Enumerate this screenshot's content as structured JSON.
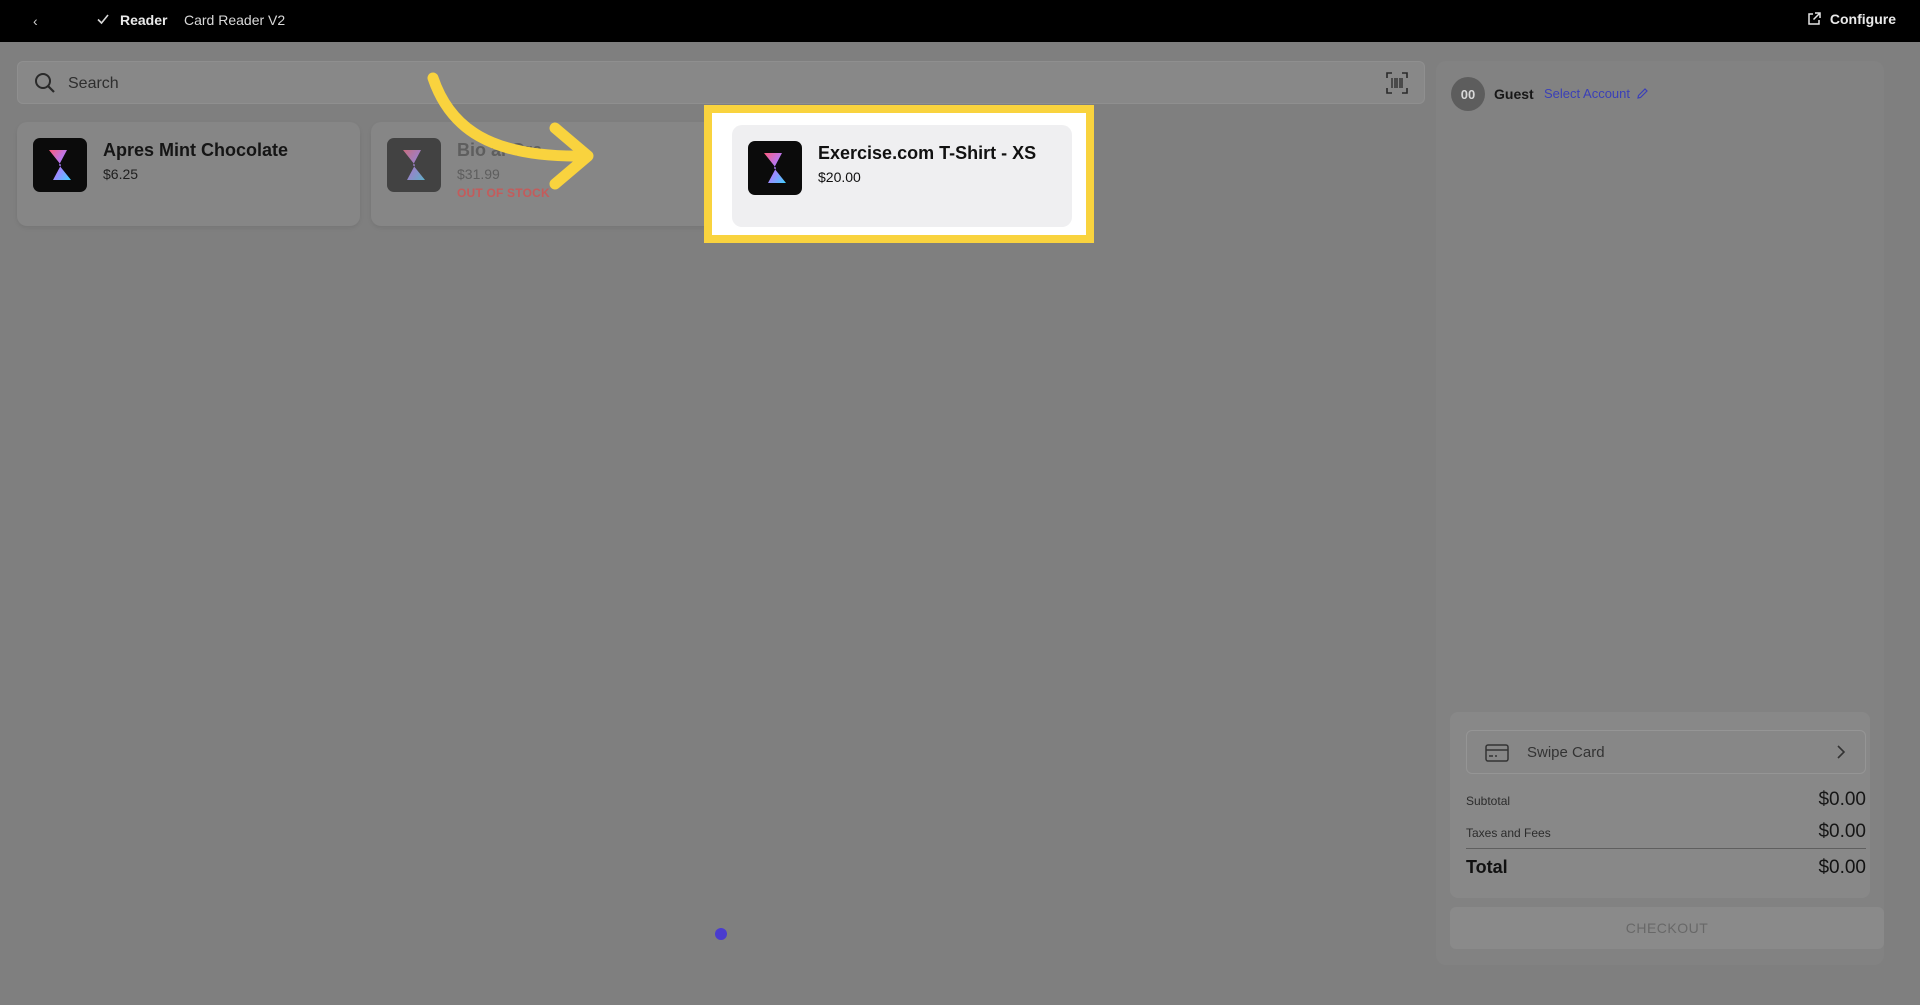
{
  "topbar": {
    "back_glyph": "‹",
    "reader_label": "Reader",
    "device_label": "Card Reader V2",
    "configure_label": "Configure"
  },
  "search": {
    "placeholder": "Search"
  },
  "products": [
    {
      "name": "Apres Mint Chocolate",
      "price": "$6.25",
      "status": ""
    },
    {
      "name": "Bio    al Gre",
      "price": "$31.99",
      "status": "OUT OF STOCK"
    },
    {
      "name": "Exercise.com T-Shirt - XS",
      "price": "$20.00",
      "status": ""
    }
  ],
  "cart": {
    "avatar_initials": "00",
    "guest_label": "Guest",
    "select_account_label": "Select Account",
    "swipe_card_label": "Swipe Card",
    "subtotal_label": "Subtotal",
    "subtotal_value": "$0.00",
    "taxes_label": "Taxes and Fees",
    "taxes_value": "$0.00",
    "total_label": "Total",
    "total_value": "$0.00",
    "checkout_label": "CHECKOUT"
  },
  "colors": {
    "highlight": "#f9d33e",
    "accent_link": "#3a3fb8",
    "out_of_stock": "#c45b5b",
    "pagination_dot": "#4a3ccf"
  },
  "icons": {
    "back": "chevron-left-icon",
    "check": "check-icon",
    "configure": "external-link-icon",
    "search": "search-icon",
    "scan": "barcode-scan-icon",
    "edit": "pencil-icon",
    "swipe": "credit-card-icon",
    "chevron": "chevron-right-icon",
    "arrow": "curved-arrow-icon"
  }
}
